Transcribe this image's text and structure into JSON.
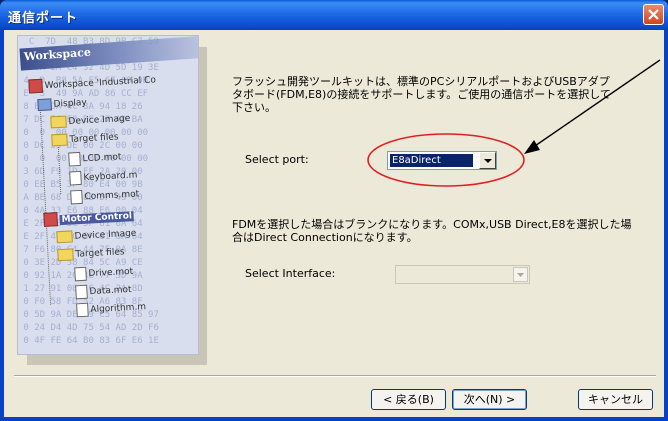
{
  "window": {
    "title": "通信ポート"
  },
  "illustration": {
    "banner": "Workspace",
    "hex_lines": [
      "  C  7D  48 B3 8D 9B C7 59",
      "         90 DA FF 5B",
      " 7 9A 2A C4 32 4D 5D 19 3E",
      " 4  D  B8 5A F5 67 09 0B",
      " E  3  49 9A AD 86 CC EF",
      " 8 EE DA 4C 8A 94 18 26",
      " 7 DC EC E8 BE 27 AD BA",
      " 0  0  00 00 00 00 00 00",
      " 0 DC 33 DE 00 2C 00 00",
      " 0  0  00 00 00 00 00 00",
      " 3 6D F9 1D FF 2A 20 00",
      " 0 EE B5 3F 80 E4 00 9B",
      " A BE 68 D9 8E 5F 49 00",
      " 0 4A 33 E6 88 E6 00 04",
      " E 2F 4E 5C 5F 61 6A 64",
      " E 2F 4E 5C 5F 61 6A 64",
      " 7 F6 80 C4 44 7E 0A 8E",
      " 0 3E 2D 58 84 5C A9 CE",
      " 0 92 1A 2C 4E 77 5D 9A",
      " 1 27 91 08 1C 4C 2A 8D",
      " 0 F0 58 FD 52 A6 83 8F",
      " 0 5D 9A DE A9 C5 64 85 97",
      " 0 24 D4 4D 75 54 AD 2D F6",
      " 0 4F FE 64 B0 83 6F E6 1E"
    ],
    "tree": {
      "workspace": "Workspace 'Industrial Co",
      "display": "Display",
      "device_image": "Device Image",
      "target_files": "Target files",
      "lcd": "LCD.mot",
      "keyboard": "Keyboard.m",
      "comms": "Comms.mot",
      "motor_control": "Motor Control",
      "device_image2": "Device Image",
      "target_files2": "Target files",
      "drive": "Drive.mot",
      "data": "Data.mot",
      "algorithm": "Algorithm.m"
    }
  },
  "content": {
    "description_top": "フラッシュ開発ツールキットは、標準のPCシリアルポートおよびUSBアダプタボード(FDM,E8)の接続をサポートします。ご使用の通信ポートを選択して下さい。",
    "select_port_label": "Select port:",
    "select_port_value": "E8aDirect",
    "description_bottom": "FDMを選択した場合はブランクになります。COMx,USB Direct,E8を選択した場合はDirect Connectionになります。",
    "select_interface_label": "Select Interface:",
    "select_interface_value": ""
  },
  "buttons": {
    "back": "< 戻る(B)",
    "next": "次へ(N) >",
    "cancel": "キャンセル"
  },
  "colors": {
    "titlebar": "#0b4ed1",
    "dialog_bg": "#ece9d8",
    "annotation_red": "#e02020",
    "selection": "#0a246a"
  }
}
